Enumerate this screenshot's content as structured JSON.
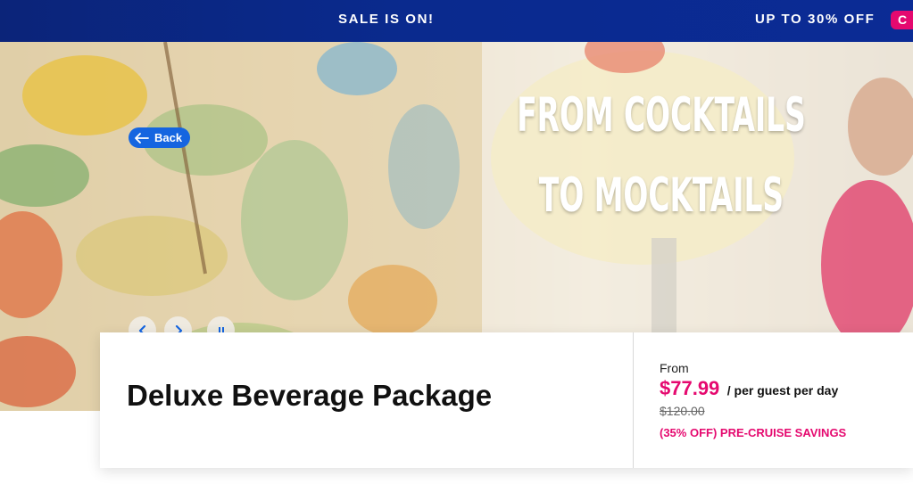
{
  "banner": {
    "sale_text": "SALE IS ON!",
    "offer_text": "UP TO 30% OFF",
    "cta_text": "C",
    "background_color": "#0b2479",
    "cta_color": "#e5096f"
  },
  "hero": {
    "headline_line1": "FROM COCKTAILS",
    "headline_line2": "TO MOCKTAILS",
    "back_label": "Back",
    "controls": {
      "prev_icon": "chevron-left-icon",
      "next_icon": "chevron-right-icon",
      "pause_icon": "pause-icon"
    },
    "accent_color": "#1565e0"
  },
  "product": {
    "title": "Deluxe Beverage Package",
    "from_label": "From",
    "price": "$77.99",
    "price_unit": "/ per guest per day",
    "original_price": "$120.00",
    "savings": "(35% OFF) PRE-CRUISE SAVINGS",
    "price_color": "#e5096f"
  }
}
